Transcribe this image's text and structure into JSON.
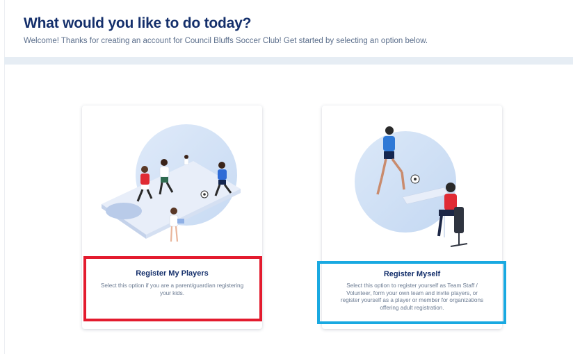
{
  "header": {
    "title": "What would you like to do today?",
    "subtitle": "Welcome! Thanks for creating an account for Council Bluffs Soccer Club! Get started by selecting an option below."
  },
  "options": [
    {
      "title": "Register My Players",
      "description": "Select this option if you are a parent/guardian registering your kids.",
      "illustration": "kids-playing-soccer-illustration",
      "highlight_color": "#e31b2e"
    },
    {
      "title": "Register Myself",
      "description": "Select this option to register yourself as Team Staff / Volunteer, form your own team and invite players, or register yourself as a player or member for organizations offering adult registration.",
      "illustration": "adult-player-and-registrant-illustration",
      "highlight_color": "#19a9e1"
    }
  ],
  "colors": {
    "title": "#142f6b",
    "subtitle": "#5c6f8c",
    "band": "#e6edf4"
  }
}
